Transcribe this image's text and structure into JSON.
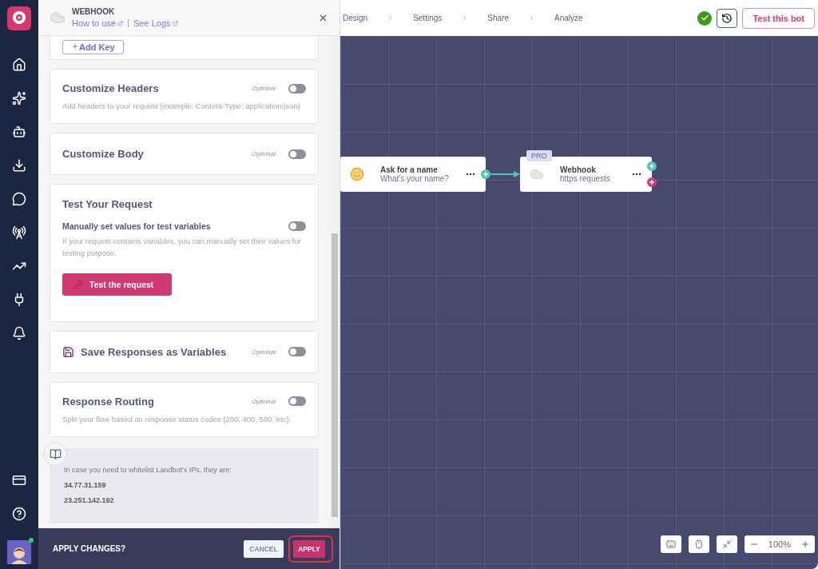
{
  "nav": {
    "avatar": {
      "online": true
    }
  },
  "panel": {
    "title": "WEBHOOK",
    "links": [
      "How to use",
      "See Logs"
    ],
    "add_key": "Add Key",
    "sections": [
      {
        "kind": "toggle",
        "title": "Customize Headers",
        "optional": "Optional",
        "on": false,
        "description": "Add headers to your request (example: Content-Type: application/json)"
      },
      {
        "kind": "toggle",
        "title": "Customize Body",
        "optional": "Optional",
        "on": false
      },
      {
        "kind": "test",
        "title": "Test Your Request",
        "option": "Manually set values for test variables",
        "on": false,
        "description": "If your request contains variables, you can manually set their values for testing purpose.",
        "button": "Test the request"
      },
      {
        "kind": "icontoggle",
        "title": "Save Responses as Variables",
        "optional": "Optional",
        "on": false
      },
      {
        "kind": "toggle",
        "title": "Response Routing",
        "optional": "Optional",
        "on": false,
        "description": "Split your flow based on response status codes (200, 400, 500, etc)."
      }
    ],
    "info": {
      "text": "In case you need to whitelist Landbot's IPs, they are:",
      "ips": [
        "34.77.31.159",
        "23.251.142.192"
      ]
    },
    "footer": {
      "question": "APPLY CHANGES?",
      "cancel": "CANCEL",
      "apply": "APPLY",
      "apply_highlighted": true
    }
  },
  "topbar": {
    "steps": [
      "Design",
      "Settings",
      "Share",
      "Analyze"
    ],
    "test_button": "Test this bot"
  },
  "canvas": {
    "nodes": [
      {
        "title": "Ask for a name",
        "subtitle": "What's your name?"
      },
      {
        "title": "Webhook",
        "subtitle": "https requests",
        "badge": "PRO"
      }
    ],
    "zoom": "100%"
  }
}
